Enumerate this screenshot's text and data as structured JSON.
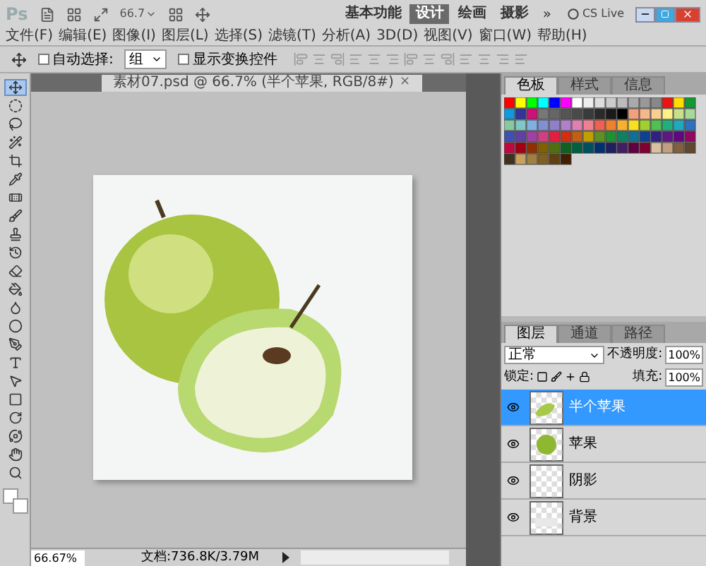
{
  "app_bar": {
    "logo": "Ps",
    "zoom": "66.7",
    "workspaces": [
      {
        "label": "基本功能",
        "selected": false
      },
      {
        "label": "设计",
        "selected": true
      },
      {
        "label": "绘画",
        "selected": false
      },
      {
        "label": "摄影",
        "selected": false
      }
    ],
    "more": "»",
    "cs_live": "CS Live"
  },
  "menu": [
    "文件(F)",
    "编辑(E)",
    "图像(I)",
    "图层(L)",
    "选择(S)",
    "滤镜(T)",
    "分析(A)",
    "3D(D)",
    "视图(V)",
    "窗口(W)",
    "帮助(H)"
  ],
  "options_bar": {
    "auto_select": {
      "label": "自动选择:",
      "checked": false
    },
    "auto_select_target": "组",
    "show_transform": {
      "label": "显示变换控件",
      "checked": false
    }
  },
  "tools": [
    {
      "kind": "move",
      "selected": true
    },
    {
      "kind": "marquee",
      "selected": false
    },
    {
      "kind": "lasso",
      "selected": false
    },
    {
      "kind": "wand",
      "selected": false
    },
    {
      "kind": "crop",
      "selected": false
    },
    {
      "kind": "eyedropper",
      "selected": false
    },
    {
      "kind": "healing",
      "selected": false
    },
    {
      "kind": "brush",
      "selected": false
    },
    {
      "kind": "stamp",
      "selected": false
    },
    {
      "kind": "history",
      "selected": false
    },
    {
      "kind": "eraser",
      "selected": false
    },
    {
      "kind": "bucket",
      "selected": false
    },
    {
      "kind": "blur",
      "selected": false
    },
    {
      "kind": "dodge",
      "selected": false
    },
    {
      "kind": "pen",
      "selected": false
    },
    {
      "kind": "type",
      "selected": false
    },
    {
      "kind": "select",
      "selected": false
    },
    {
      "kind": "shape",
      "selected": false
    },
    {
      "kind": "rotate",
      "selected": false
    },
    {
      "kind": "orbit",
      "selected": false
    },
    {
      "kind": "hand",
      "selected": false
    },
    {
      "kind": "zoom",
      "selected": false
    }
  ],
  "document": {
    "tab_title": "素材07.psd @ 66.7% (半个苹果, RGB/8#)",
    "close": "×",
    "zoom": "66.67%",
    "doc_size": "文档:736.8K/3.79M"
  },
  "swatches_panel": {
    "tabs": [
      {
        "label": "色板",
        "selected": true
      },
      {
        "label": "样式",
        "selected": false
      },
      {
        "label": "信息",
        "selected": false
      }
    ]
  },
  "layers_panel": {
    "tabs": [
      {
        "label": "图层",
        "selected": true
      },
      {
        "label": "通道",
        "selected": false
      },
      {
        "label": "路径",
        "selected": false
      }
    ],
    "blend_mode": "正常",
    "opacity_label": "不透明度:",
    "opacity": "100%",
    "lock_label": "锁定:",
    "fill_label": "填充:",
    "fill": "100%",
    "layers": [
      {
        "name": "半个苹果",
        "visible": true,
        "selected": true,
        "kind": "half"
      },
      {
        "name": "苹果",
        "visible": true,
        "selected": false,
        "kind": "apple"
      },
      {
        "name": "阴影",
        "visible": true,
        "selected": false,
        "kind": "empty"
      },
      {
        "name": "背景",
        "visible": true,
        "selected": false,
        "kind": "background"
      }
    ]
  }
}
